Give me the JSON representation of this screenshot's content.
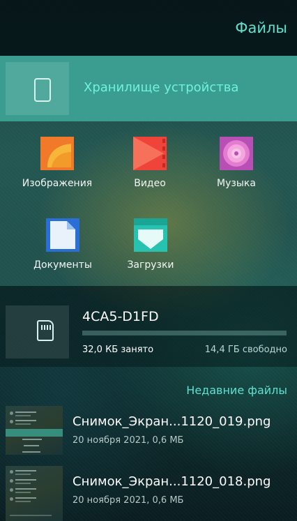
{
  "header": {
    "title": "Файлы"
  },
  "storage": {
    "label": "Хранилище устройства"
  },
  "categories": [
    {
      "name": "Изображения",
      "icon": "images-icon"
    },
    {
      "name": "Видео",
      "icon": "video-icon"
    },
    {
      "name": "Музыка",
      "icon": "music-icon"
    },
    {
      "name": "Документы",
      "icon": "documents-icon"
    },
    {
      "name": "Загрузки",
      "icon": "downloads-icon"
    }
  ],
  "sd_card": {
    "name": "4CA5-D1FD",
    "used": "32,0 КБ занято",
    "free": "14,4 ГБ свободно",
    "used_fraction": 0.0
  },
  "recent": {
    "title": "Недавние файлы",
    "files": [
      {
        "name": "Снимок_Экран...1120_019.png",
        "meta": "20 ноября 2021, 0,6 МБ"
      },
      {
        "name": "Снимок_Экран...1120_018.png",
        "meta": "20 ноября 2021, 0,6 МБ"
      }
    ]
  },
  "colors": {
    "accent": "#5fe0cf",
    "storage_bar": "#3a9d8f",
    "images_icon": "#f07a2a",
    "video_icon": "#f0443a",
    "music_icon": "#d96ac8",
    "documents_icon": "#2a6fd6",
    "downloads_icon": "#27c2b0"
  }
}
